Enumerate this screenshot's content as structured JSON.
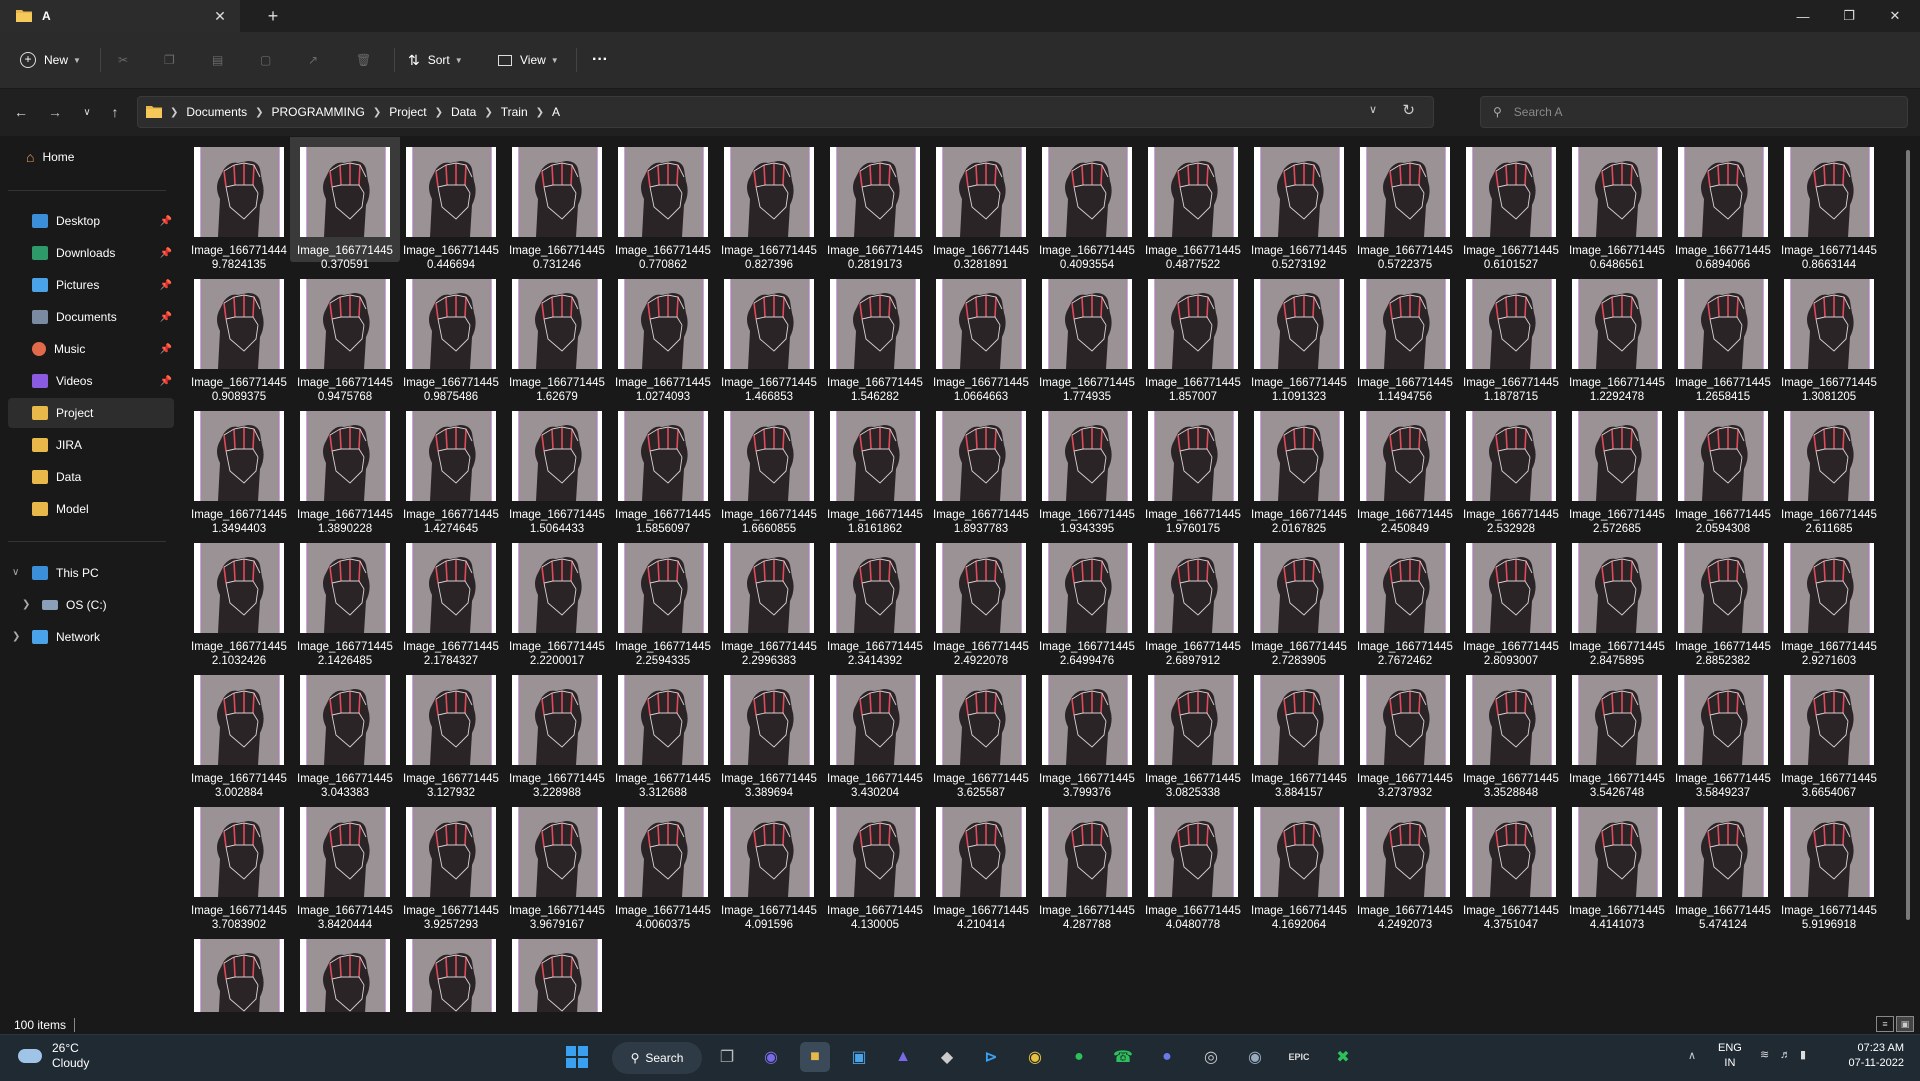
{
  "window": {
    "tab_title": "A",
    "new_tab_symbol": "+",
    "close_tab_symbol": "✕"
  },
  "commandbar": {
    "new_label": "New",
    "sort_label": "Sort",
    "view_label": "View",
    "more_symbol": "···"
  },
  "address": {
    "crumbs": [
      "Documents",
      "PROGRAMMING",
      "Project",
      "Data",
      "Train",
      "A"
    ],
    "search_placeholder": "Search A"
  },
  "sidebar": {
    "home": "Home",
    "quick": [
      {
        "label": "Desktop",
        "color": "#3a8fd8"
      },
      {
        "label": "Downloads",
        "color": "#2e9a6a"
      },
      {
        "label": "Pictures",
        "color": "#4aa3e8"
      },
      {
        "label": "Documents",
        "color": "#7a8aa0"
      },
      {
        "label": "Music",
        "color": "#e06a4a"
      },
      {
        "label": "Videos",
        "color": "#8a5ae0"
      },
      {
        "label": "Project",
        "color": "#e8b84a"
      },
      {
        "label": "JIRA",
        "color": "#e8b84a"
      },
      {
        "label": "Data",
        "color": "#e8b84a"
      },
      {
        "label": "Model",
        "color": "#e8b84a"
      }
    ],
    "this_pc": "This PC",
    "os_drive": "OS (C:)",
    "network": "Network"
  },
  "files": [
    [
      "Image_166771444",
      "9.7824135"
    ],
    [
      "Image_166771445",
      "0.370591"
    ],
    [
      "Image_166771445",
      "0.446694"
    ],
    [
      "Image_166771445",
      "0.731246"
    ],
    [
      "Image_166771445",
      "0.770862"
    ],
    [
      "Image_166771445",
      "0.827396"
    ],
    [
      "Image_166771445",
      "0.2819173"
    ],
    [
      "Image_166771445",
      "0.3281891"
    ],
    [
      "Image_166771445",
      "0.4093554"
    ],
    [
      "Image_166771445",
      "0.4877522"
    ],
    [
      "Image_166771445",
      "0.5273192"
    ],
    [
      "Image_166771445",
      "0.5722375"
    ],
    [
      "Image_166771445",
      "0.6101527"
    ],
    [
      "Image_166771445",
      "0.6486561"
    ],
    [
      "Image_166771445",
      "0.6894066"
    ],
    [
      "Image_166771445",
      "0.8663144"
    ],
    [
      "Image_166771445",
      "0.9089375"
    ],
    [
      "Image_166771445",
      "0.9475768"
    ],
    [
      "Image_166771445",
      "0.9875486"
    ],
    [
      "Image_166771445",
      "1.62679"
    ],
    [
      "Image_166771445",
      "1.0274093"
    ],
    [
      "Image_166771445",
      "1.466853"
    ],
    [
      "Image_166771445",
      "1.546282"
    ],
    [
      "Image_166771445",
      "1.0664663"
    ],
    [
      "Image_166771445",
      "1.774935"
    ],
    [
      "Image_166771445",
      "1.857007"
    ],
    [
      "Image_166771445",
      "1.1091323"
    ],
    [
      "Image_166771445",
      "1.1494756"
    ],
    [
      "Image_166771445",
      "1.1878715"
    ],
    [
      "Image_166771445",
      "1.2292478"
    ],
    [
      "Image_166771445",
      "1.2658415"
    ],
    [
      "Image_166771445",
      "1.3081205"
    ],
    [
      "Image_166771445",
      "1.3494403"
    ],
    [
      "Image_166771445",
      "1.3890228"
    ],
    [
      "Image_166771445",
      "1.4274645"
    ],
    [
      "Image_166771445",
      "1.5064433"
    ],
    [
      "Image_166771445",
      "1.5856097"
    ],
    [
      "Image_166771445",
      "1.6660855"
    ],
    [
      "Image_166771445",
      "1.8161862"
    ],
    [
      "Image_166771445",
      "1.8937783"
    ],
    [
      "Image_166771445",
      "1.9343395"
    ],
    [
      "Image_166771445",
      "1.9760175"
    ],
    [
      "Image_166771445",
      "2.0167825"
    ],
    [
      "Image_166771445",
      "2.450849"
    ],
    [
      "Image_166771445",
      "2.532928"
    ],
    [
      "Image_166771445",
      "2.572685"
    ],
    [
      "Image_166771445",
      "2.0594308"
    ],
    [
      "Image_166771445",
      "2.611685"
    ],
    [
      "Image_166771445",
      "2.1032426"
    ],
    [
      "Image_166771445",
      "2.1426485"
    ],
    [
      "Image_166771445",
      "2.1784327"
    ],
    [
      "Image_166771445",
      "2.2200017"
    ],
    [
      "Image_166771445",
      "2.2594335"
    ],
    [
      "Image_166771445",
      "2.2996383"
    ],
    [
      "Image_166771445",
      "2.3414392"
    ],
    [
      "Image_166771445",
      "2.4922078"
    ],
    [
      "Image_166771445",
      "2.6499476"
    ],
    [
      "Image_166771445",
      "2.6897912"
    ],
    [
      "Image_166771445",
      "2.7283905"
    ],
    [
      "Image_166771445",
      "2.7672462"
    ],
    [
      "Image_166771445",
      "2.8093007"
    ],
    [
      "Image_166771445",
      "2.8475895"
    ],
    [
      "Image_166771445",
      "2.8852382"
    ],
    [
      "Image_166771445",
      "2.9271603"
    ],
    [
      "Image_166771445",
      "3.002884"
    ],
    [
      "Image_166771445",
      "3.043383"
    ],
    [
      "Image_166771445",
      "3.127932"
    ],
    [
      "Image_166771445",
      "3.228988"
    ],
    [
      "Image_166771445",
      "3.312688"
    ],
    [
      "Image_166771445",
      "3.389694"
    ],
    [
      "Image_166771445",
      "3.430204"
    ],
    [
      "Image_166771445",
      "3.625587"
    ],
    [
      "Image_166771445",
      "3.799376"
    ],
    [
      "Image_166771445",
      "3.0825338"
    ],
    [
      "Image_166771445",
      "3.884157"
    ],
    [
      "Image_166771445",
      "3.2737932"
    ],
    [
      "Image_166771445",
      "3.3528848"
    ],
    [
      "Image_166771445",
      "3.5426748"
    ],
    [
      "Image_166771445",
      "3.5849237"
    ],
    [
      "Image_166771445",
      "3.6654067"
    ],
    [
      "Image_166771445",
      "3.7083902"
    ],
    [
      "Image_166771445",
      "3.8420444"
    ],
    [
      "Image_166771445",
      "3.9257293"
    ],
    [
      "Image_166771445",
      "3.9679167"
    ],
    [
      "Image_166771445",
      "4.0060375"
    ],
    [
      "Image_166771445",
      "4.091596"
    ],
    [
      "Image_166771445",
      "4.130005"
    ],
    [
      "Image_166771445",
      "4.210414"
    ],
    [
      "Image_166771445",
      "4.287788"
    ],
    [
      "Image_166771445",
      "4.0480778"
    ],
    [
      "Image_166771445",
      "4.1692064"
    ],
    [
      "Image_166771445",
      "4.2492073"
    ],
    [
      "Image_166771445",
      "4.3751047"
    ],
    [
      "Image_166771445",
      "4.4141073"
    ],
    [
      "Image_166771445",
      "5.474124"
    ],
    [
      "Image_166771445",
      "5.9196918"
    ],
    [
      "",
      ""
    ],
    [
      "",
      ""
    ],
    [
      "",
      ""
    ],
    [
      "",
      ""
    ]
  ],
  "selected_index": 1,
  "status": {
    "count": "100 items"
  },
  "taskbar": {
    "temperature": "26°C",
    "condition": "Cloudy",
    "search_label": "Search",
    "lang": "ENG",
    "region": "IN",
    "time": "07:23 AM",
    "date": "07-11-2022"
  }
}
